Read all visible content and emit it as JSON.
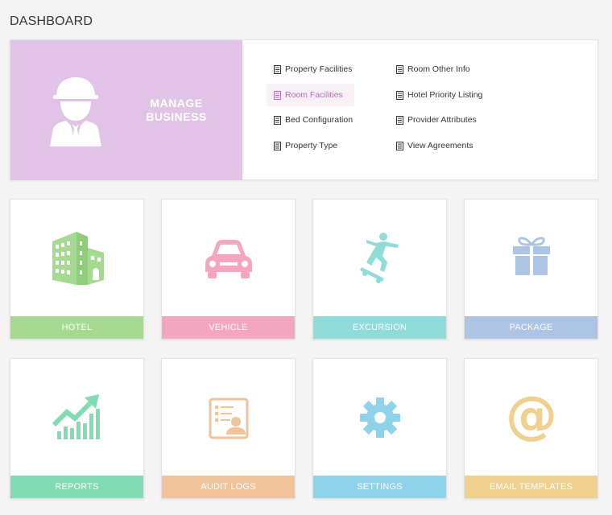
{
  "page": {
    "title": "DASHBOARD"
  },
  "manage_business": {
    "title_line1": "MANAGE",
    "title_line2": "BUSINESS",
    "color": "#e0c3e6",
    "links": [
      {
        "label": "Property Facilities",
        "active": false
      },
      {
        "label": "Room Facilities",
        "active": true
      },
      {
        "label": "Bed Configuration",
        "active": false
      },
      {
        "label": "Property Type",
        "active": false
      },
      {
        "label": "Room Other Info",
        "active": false
      },
      {
        "label": "Hotel Priority Listing",
        "active": false
      },
      {
        "label": "Provider Attributes",
        "active": false
      },
      {
        "label": "View Agreements",
        "active": false
      }
    ]
  },
  "tiles": [
    {
      "label": "HOTEL",
      "icon": "building-icon",
      "color": "#a6da93"
    },
    {
      "label": "VEHICLE",
      "icon": "car-icon",
      "color": "#f4a6c0"
    },
    {
      "label": "EXCURSION",
      "icon": "skateboarder-icon",
      "color": "#8fdcd8"
    },
    {
      "label": "PACKAGE",
      "icon": "gift-icon",
      "color": "#aec4e4"
    },
    {
      "label": "REPORTS",
      "icon": "growth-chart-icon",
      "color": "#82dcb3"
    },
    {
      "label": "AUDIT LOGS",
      "icon": "id-card-icon",
      "color": "#f0c39a"
    },
    {
      "label": "SETTINGS",
      "icon": "gear-icon",
      "color": "#8fd2ec"
    },
    {
      "label": "EMAIL TEMPLATES",
      "icon": "at-sign-icon",
      "color": "#efd08f"
    }
  ]
}
